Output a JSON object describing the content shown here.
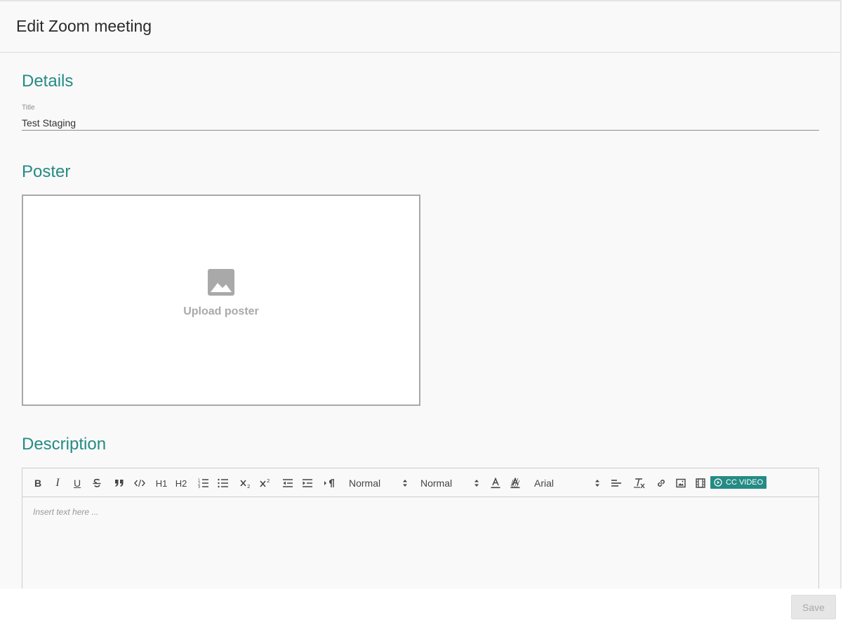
{
  "dialog": {
    "title": "Edit Zoom meeting"
  },
  "details": {
    "section_title": "Details",
    "title_field": {
      "label": "Title",
      "value": "Test Staging"
    }
  },
  "poster": {
    "section_title": "Poster",
    "upload_label": "Upload poster",
    "icon": "image-icon"
  },
  "description": {
    "section_title": "Description",
    "placeholder": "Insert text here ...",
    "toolbar": {
      "buttons": [
        "bold",
        "italic",
        "underline",
        "strikethrough",
        "blockquote",
        "code-block",
        "header-1",
        "header-2",
        "ordered-list",
        "bullet-list",
        "subscript",
        "superscript",
        "outdent",
        "indent",
        "text-direction",
        "font-color",
        "background-color",
        "align",
        "clean-format",
        "link",
        "image",
        "video"
      ],
      "bold_label": "B",
      "italic_label": "I",
      "underline_label": "U",
      "h1_label": "H1",
      "h2_label": "H2",
      "header_picker_value": "Normal",
      "size_picker_value": "Normal",
      "font_picker_value": "Arial",
      "cc_video_label": "CC VIDEO"
    }
  },
  "footer": {
    "save_label": "Save"
  },
  "colors": {
    "accent": "#258b84",
    "background": "#f9f9f9",
    "disabled_button": "#e6e6e6"
  }
}
